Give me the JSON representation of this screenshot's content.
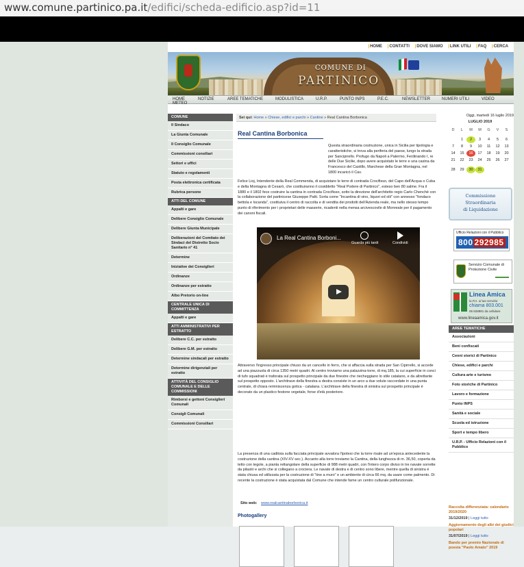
{
  "browser": {
    "url_domain": "www.comune.partinico.pa.it",
    "url_path": "/edifici/scheda-edificio.asp?id=11"
  },
  "toplinks": [
    "HOME",
    "CONTATTI",
    "DOVE SIAMO",
    "LINK UTILI",
    "FAQ",
    "CERCA"
  ],
  "banner": {
    "title_small": "COMUNE DI",
    "title_large": "PARTINICO"
  },
  "nav": [
    "HOME",
    "METEO",
    "NOTIZIE",
    "AREE TEMATICHE",
    "MODULISTICA",
    "U.R.P.",
    "PUNTO INPS",
    "P.E.C.",
    "NEWSLETTER",
    "NUMERI UTILI",
    "VIDEO"
  ],
  "left": {
    "comune_head": "COMUNE",
    "comune": [
      "Il Sindaco",
      "La Giunta Comunale",
      "Il Consiglio Comunale",
      "Commissioni consiliari",
      "Settori e uffici",
      "Statuto e regolamenti",
      "Posta elettronica certificata",
      "Rubrica persone"
    ],
    "atti_head": "ATTI DEL COMUNE",
    "atti": [
      "Appalti e gare",
      "Delibere Consiglio Comunale",
      "Delibere Giunta Municipale",
      "Deliberazioni del Comitato dei Sindaci del Distretto Socio Sanitario n° 41",
      "Determine",
      "Iniziative dei Consiglieri",
      "Ordinanze",
      "Ordinanze per estratto",
      "Albo Pretorio on-line"
    ],
    "centrale_head": "CENTRALE UNICA DI COMMITTENZA",
    "centrale": [
      "Appalti e gare"
    ],
    "amm_head": "ATTI AMMINISTRATIVI PER ESTRATTO",
    "amm": [
      "Delibere C.C. per estratto",
      "Delibere G.M. per estratto",
      "Determine sindacali per estratto",
      "Determine dirigenziali per estratto"
    ],
    "att_head": "ATTIVITÀ DEL CONSIGLIO COMUNALE E DELLE COMMISSIONI",
    "att": [
      "Rimborsi e gettoni Consiglieri Comunali",
      "Consigli Comunali",
      "Commissioni Consiliari"
    ]
  },
  "crumb": {
    "label": "Sei qui:",
    "home": "Home",
    "sep1": "»",
    "cat": "Chiese, edifici e parchi",
    "sep2": "»",
    "sub": "Cantine",
    "sep3": "»",
    "current": "Real Cantina Borbonica"
  },
  "main": {
    "title": "Real Cantina Borbonica",
    "p1": "Questa straordinaria costruzione, unica in Sicilia per tipologia e caratteristiche, si trova alla periferia del paese, lungo la strada per Sancipirello. Profugo da Napoli a Palermo, Ferdinando I, re delle Due Sicilie, dopo avere acquistato le terre e una casina da Francesco del Castillo, Marchese della Gran Montagna, nel 1800 incaricò il Cav.",
    "p2": "Felice Lioj, Intendente della Real Commenda, di acquistare le terre di contrada Crocifisso, del Capo dell'Acqua o Cuba e della Montagna di Cesarò, che costituiranno il cosiddetto \"Real Podere di Partinico\", esteso ben 80 salme. Fra il 1880 e il 1802 fece costruire la cantina in contrada Crocifisso, sotto la direzione dell'architetto regio Carlo Chenchè con la collaborazione del partinicese Giuseppe Patti. Sorta come \"Incantina di vino, liquori ed olii\" con annesso \"fondaco bettola e locanda\", costituiva il centro di raccolta e di vendita dei prodotti dell'Azienda reale, ma nello stesso tempo punto di riferimento per i proprietari delle masserie, ricadenti nella mensa arcivescovile di Monreale per il pagamento dei canoni fiscali.",
    "p3": "Attraverso l'ingresso principale chiuso da un cancello in ferro, che si affaccia sulla strada per San Cipirrello, si accede ad una piazzuola di circa 1350 metri quadri. Al centro troviamo una palazzina-torre, di mq.185, la cui superficie in conci di tufo squadrati è traforata sul prospetto principale da due finestre che riecheggiano lo stile catalano, e da altrettante sul prospetto opposto. L'architrave della finestra a destra consiste in un arco a due volute raccordate in una punta centrale, di chiara reminiscenza gotica - catalana. L'architrave della finestra di sinistra sul prospetto principale è decorato da un plastico festone vegetale, forse d'età posteriore.",
    "p4": "La presenza di una caditoia sulla facciata principale avvalora l'ipotesi che la torre risale ad un'epoca antecedente la costruzione della cantina (XIV-XV sec.). Accanto alla torre troviamo la Cantina, della lunghezza di m. 36,50, coperta da tetto con tegole, a pianta rettangolare della superficie di 988 metri quadri, con l'intero corpo diviso in tre navate sorrette da pilastri e archi che si collegano a crociera. Le navate di destra e di centro sono libere, mentre quella di sinistra è stata chiusa ed utilizzata per la costruzione di \"tine a muro\" e un ambiente di circa 66 mq. da usare come palmento. Di recente la costruzione è stata acquistata dal Comune che intende farne un centro culturale polifunzionale.",
    "video_title": "La Real Cantina Borboni...",
    "video_later": "Guarda più tardi",
    "video_share": "Condividi",
    "site_label": "Sito web:",
    "site_url": "www.realcantinaborbonica.it",
    "gallery": "Photogallery"
  },
  "right": {
    "date": "Oggi, martedì 16 luglio 2019",
    "month": "LUGLIO 2019",
    "dayheads": [
      "D",
      "L",
      "M",
      "M",
      "G",
      "V",
      "S"
    ],
    "calendar": [
      [
        "",
        "1",
        "2",
        "3",
        "4",
        "5",
        "6"
      ],
      [
        "7",
        "8",
        "9",
        "10",
        "11",
        "12",
        "13"
      ],
      [
        "14",
        "15",
        "16",
        "17",
        "18",
        "19",
        "20"
      ],
      [
        "21",
        "22",
        "23",
        "24",
        "25",
        "26",
        "27"
      ],
      [
        "28",
        "29",
        "30",
        "31",
        "",
        "",
        ""
      ]
    ],
    "comm": [
      "Commissione",
      "Straordinaria",
      "di Liquidazione"
    ],
    "urp_title": "Ufficio Relazioni con il Pubblico",
    "urp_num1": "800",
    "urp_num2": "292985",
    "pc_text": "Servizio Comunale di Protezione Civile",
    "linea": {
      "title": "Linea Amica",
      "sub": "la P.A. al tuo servizio",
      "call": "chiama 803.001",
      "alt": "06 828881 da cellulare",
      "url": "www.lineaamica.gov.it"
    },
    "aree_head": "AREE TEMATICHE",
    "aree": [
      "Associazioni",
      "Beni confiscati",
      "Cenni storici di Partinico",
      "Chiese, edifici e parchi",
      "Cultura arte e turismo",
      "Foto storiche di Partinico",
      "Lavoro e formazione",
      "Punto INPS",
      "Sanità e sociale",
      "Scuola ed istruzione",
      "Sport e tempo libero",
      "U.R.P. - Ufficio Relazioni con il Pubblico"
    ],
    "news": [
      {
        "title": "Raccolta differenziata: calendario 2019/2020",
        "date": "31/12/2019",
        "more": "Leggi tutto"
      },
      {
        "title": "Aggiornamento degli albi dei giudici popolari",
        "date": "31/07/2019",
        "more": "Leggi tutto"
      },
      {
        "title": "Bando per premio Nazionale di poesia \"Paolo Amato\" 2019",
        "date": "",
        "more": ""
      }
    ]
  },
  "colors": {
    "accent": "#1a3d7a",
    "link": "#2a5db0",
    "news": "#c06a10",
    "section_bg": "#5a5a5a"
  }
}
